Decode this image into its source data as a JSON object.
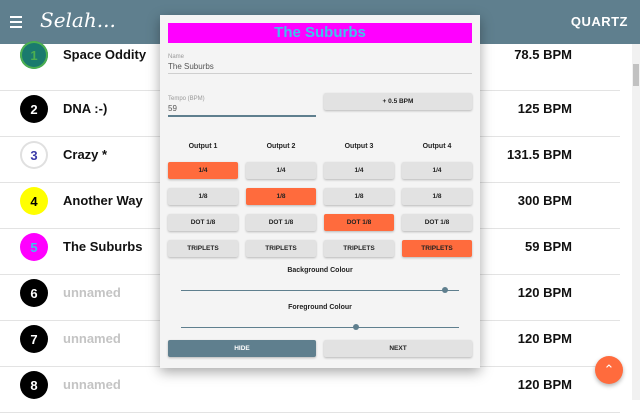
{
  "app": {
    "title": "Selah...",
    "right_label": "QUARTZ"
  },
  "songs": [
    {
      "num": "1",
      "name": "Space Oddity",
      "bpm": "78.5 BPM",
      "color": "#1a7a6e",
      "ring": "#4caf50",
      "num_color": "#4caf50",
      "unnamed": false
    },
    {
      "num": "2",
      "name": "DNA :-)",
      "bpm": "125 BPM",
      "color": "#000000",
      "ring": "",
      "num_color": "#ffffff",
      "unnamed": false
    },
    {
      "num": "3",
      "name": "Crazy *",
      "bpm": "131.5 BPM",
      "color": "#ffffff",
      "ring": "#e0e0e0",
      "num_color": "#3a3aa8",
      "unnamed": false
    },
    {
      "num": "4",
      "name": "Another Way",
      "bpm": "300 BPM",
      "color": "#ffff00",
      "ring": "",
      "num_color": "#000000",
      "unnamed": false
    },
    {
      "num": "5",
      "name": "The Suburbs",
      "bpm": "59 BPM",
      "color": "#ff00ff",
      "ring": "",
      "num_color": "#3ec1ee",
      "unnamed": false
    },
    {
      "num": "6",
      "name": "unnamed",
      "bpm": "120 BPM",
      "color": "#000000",
      "ring": "",
      "num_color": "#ffffff",
      "unnamed": true
    },
    {
      "num": "7",
      "name": "unnamed",
      "bpm": "120 BPM",
      "color": "#000000",
      "ring": "",
      "num_color": "#ffffff",
      "unnamed": true
    },
    {
      "num": "8",
      "name": "unnamed",
      "bpm": "120 BPM",
      "color": "#000000",
      "ring": "",
      "num_color": "#ffffff",
      "unnamed": true
    }
  ],
  "dialog": {
    "title": "The Suburbs",
    "name_label": "Name",
    "name_value": "The Suburbs",
    "tempo_label": "Tempo (BPM)",
    "tempo_value": "59",
    "increment_button": "+ 0.5 BPM",
    "outputs": [
      "Output 1",
      "Output 2",
      "Output 3",
      "Output 4"
    ],
    "rows": [
      "1/4",
      "1/8",
      "DOT 1/8",
      "TRIPLETS"
    ],
    "selected": [
      0,
      1,
      2,
      3
    ],
    "background_label": "Background Colour",
    "background_level": 0.95,
    "foreground_label": "Foreground Colour",
    "foreground_level": 0.63,
    "hide_button": "HIDE",
    "next_button": "NEXT"
  },
  "colors": {
    "accent": "#ff6b3d",
    "primary": "#5f7f8e",
    "title_bg": "#ff00ff",
    "title_fg": "#3ec1ee"
  }
}
